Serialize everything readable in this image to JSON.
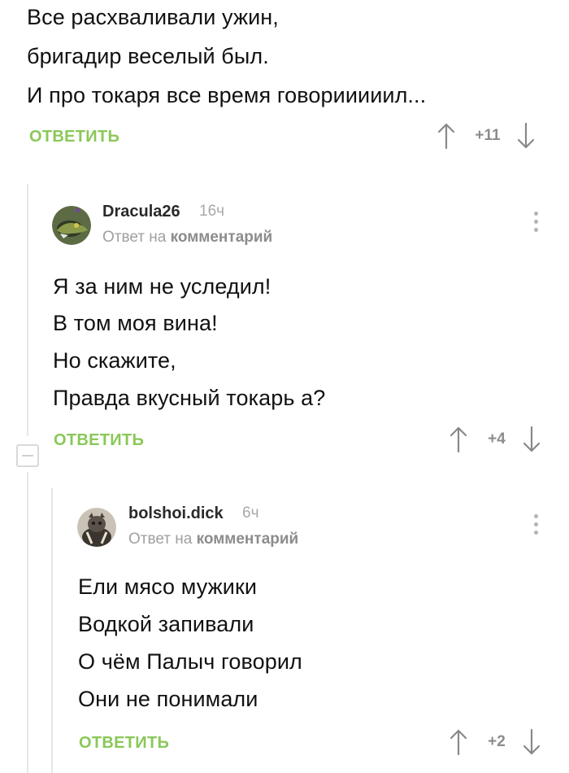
{
  "comments": [
    {
      "lines": [
        "Все расхваливали ужин,",
        "бригадир веселый был.",
        "И про токаря все время говорииииил..."
      ],
      "reply_label": "ОТВЕТИТЬ",
      "score": "+11"
    },
    {
      "author": "Dracula26",
      "time": "16ч",
      "reply_prefix": "Ответ на",
      "reply_target": "комментарий",
      "lines": [
        "Я за ним не уследил!",
        "В том моя вина!",
        "Но скажите,",
        "Правда вкусный токарь а?"
      ],
      "reply_label": "ОТВЕТИТЬ",
      "score": "+4"
    },
    {
      "author": "bolshoi.dick",
      "time": "6ч",
      "reply_prefix": "Ответ на",
      "reply_target": "комментарий",
      "lines": [
        "Ели мясо мужики",
        "Водкой запивали",
        "О чём Палыч говорил",
        "Они не понимали"
      ],
      "reply_label": "ОТВЕТИТЬ",
      "score": "+2"
    }
  ],
  "icons": {
    "upvote": "arrow-up-icon",
    "downvote": "arrow-down-icon",
    "more": "more-vertical-icon",
    "collapse": "collapse-minus-icon"
  },
  "colors": {
    "reply_green": "#8ac858",
    "muted_gray": "#8c8c8c",
    "thread_line": "#e6e6e6"
  }
}
